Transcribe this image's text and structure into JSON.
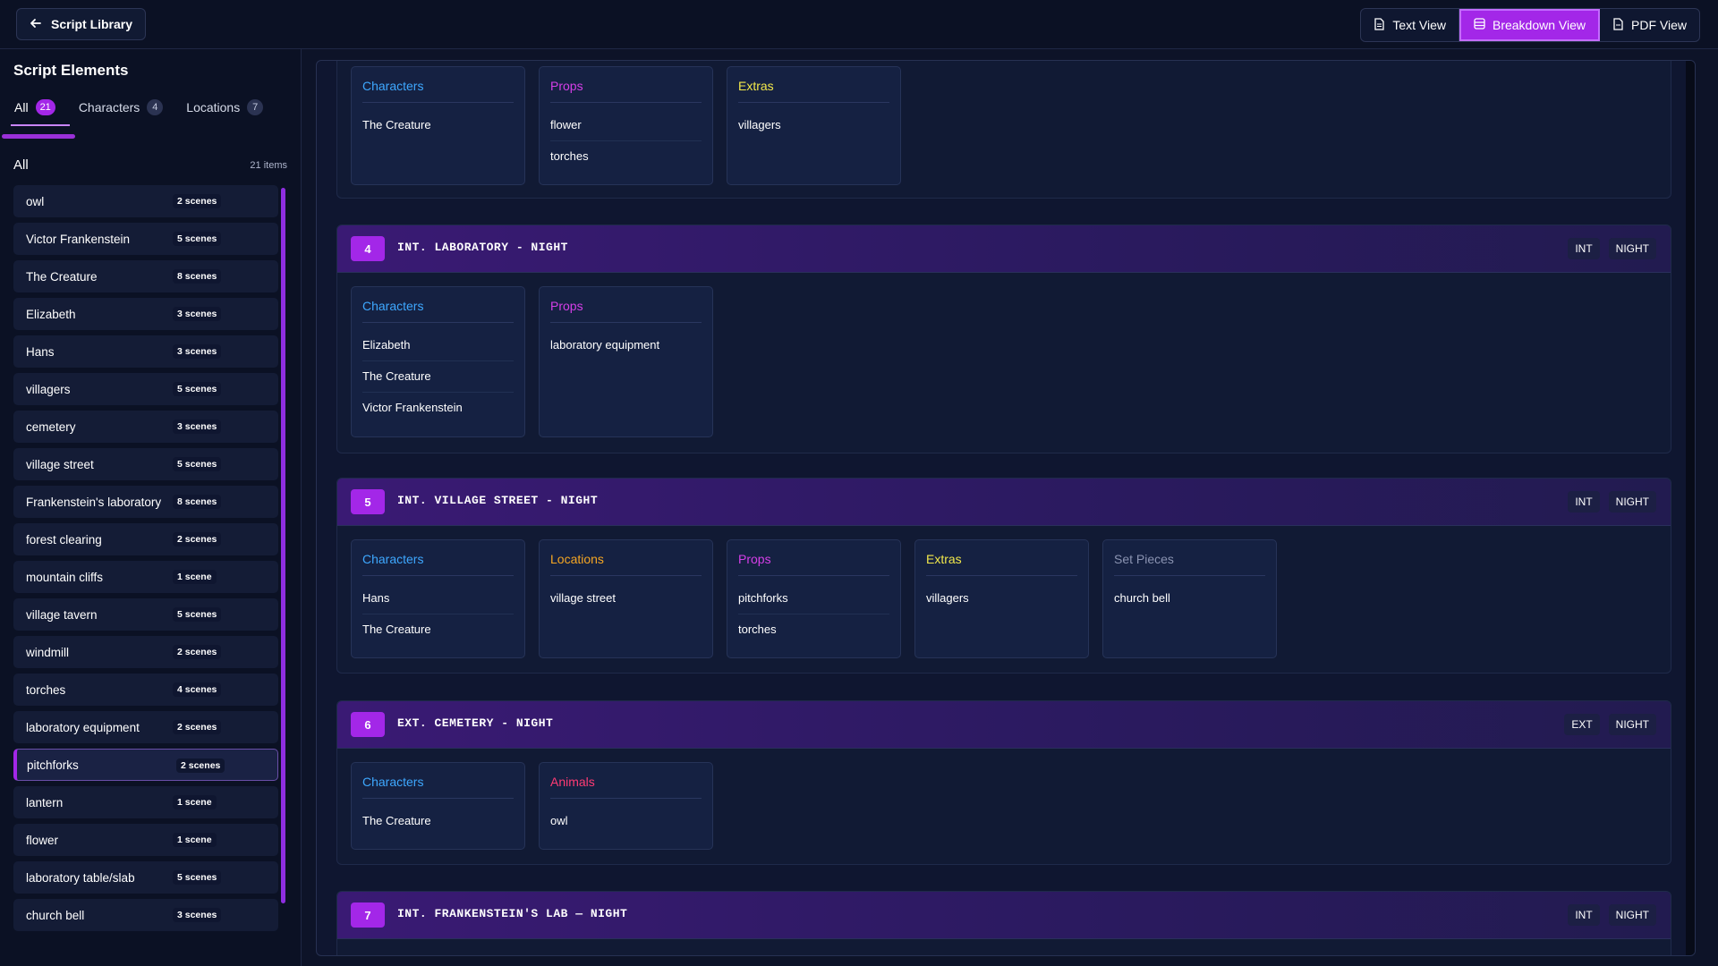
{
  "header": {
    "back_label": "Script Library",
    "views": [
      {
        "label": "Text View",
        "active": false
      },
      {
        "label": "Breakdown View",
        "active": true
      },
      {
        "label": "PDF View",
        "active": false
      }
    ]
  },
  "sidebar": {
    "title": "Script Elements",
    "tabs": [
      {
        "label": "All",
        "count": "21",
        "active": true
      },
      {
        "label": "Characters",
        "count": "4",
        "active": false
      },
      {
        "label": "Locations",
        "count": "7",
        "active": false
      }
    ],
    "list_title": "All",
    "list_count": "21 items",
    "items": [
      {
        "name": "owl",
        "scenes": "2 scenes"
      },
      {
        "name": "Victor Frankenstein",
        "scenes": "5 scenes"
      },
      {
        "name": "The Creature",
        "scenes": "8 scenes"
      },
      {
        "name": "Elizabeth",
        "scenes": "3 scenes"
      },
      {
        "name": "Hans",
        "scenes": "3 scenes"
      },
      {
        "name": "villagers",
        "scenes": "5 scenes"
      },
      {
        "name": "cemetery",
        "scenes": "3 scenes"
      },
      {
        "name": "village street",
        "scenes": "5 scenes"
      },
      {
        "name": "Frankenstein's laboratory",
        "scenes": "8 scenes"
      },
      {
        "name": "forest clearing",
        "scenes": "2 scenes"
      },
      {
        "name": "mountain cliffs",
        "scenes": "1 scene"
      },
      {
        "name": "village tavern",
        "scenes": "5 scenes"
      },
      {
        "name": "windmill",
        "scenes": "2 scenes"
      },
      {
        "name": "torches",
        "scenes": "4 scenes"
      },
      {
        "name": "laboratory equipment",
        "scenes": "2 scenes"
      },
      {
        "name": "pitchforks",
        "scenes": "2 scenes",
        "selected": true
      },
      {
        "name": "lantern",
        "scenes": "1 scene"
      },
      {
        "name": "flower",
        "scenes": "1 scene"
      },
      {
        "name": "laboratory table/slab",
        "scenes": "5 scenes"
      },
      {
        "name": "church bell",
        "scenes": "3 scenes"
      }
    ]
  },
  "colors": {
    "accent": "#a327e8",
    "characters": "#3ea8ff",
    "props": "#d63fe8",
    "extras": "#f2e84b",
    "locations": "#f5a623",
    "set_pieces": "#8a93b1",
    "animals": "#ff3b74"
  },
  "scenes": [
    {
      "number": "",
      "heading": "",
      "tags": [],
      "categories": [
        {
          "title": "Characters",
          "kind": "characters",
          "items": [
            "The Creature"
          ]
        },
        {
          "title": "Props",
          "kind": "props",
          "items": [
            "flower",
            "torches"
          ]
        },
        {
          "title": "Extras",
          "kind": "extras",
          "items": [
            "villagers"
          ]
        }
      ]
    },
    {
      "number": "4",
      "heading": "INT. LABORATORY - NIGHT",
      "tags": [
        "INT",
        "NIGHT"
      ],
      "categories": [
        {
          "title": "Characters",
          "kind": "characters",
          "items": [
            "Elizabeth",
            "The Creature",
            "Victor Frankenstein"
          ]
        },
        {
          "title": "Props",
          "kind": "props",
          "items": [
            "laboratory equipment"
          ]
        }
      ]
    },
    {
      "number": "5",
      "heading": "INT. VILLAGE STREET - NIGHT",
      "tags": [
        "INT",
        "NIGHT"
      ],
      "categories": [
        {
          "title": "Characters",
          "kind": "characters",
          "items": [
            "Hans",
            "The Creature"
          ]
        },
        {
          "title": "Locations",
          "kind": "locations",
          "items": [
            "village street"
          ]
        },
        {
          "title": "Props",
          "kind": "props",
          "items": [
            "pitchforks",
            "torches"
          ]
        },
        {
          "title": "Extras",
          "kind": "extras",
          "items": [
            "villagers"
          ]
        },
        {
          "title": "Set Pieces",
          "kind": "setpieces",
          "items": [
            "church bell"
          ]
        }
      ]
    },
    {
      "number": "6",
      "heading": "EXT. CEMETERY - NIGHT",
      "tags": [
        "EXT",
        "NIGHT"
      ],
      "categories": [
        {
          "title": "Characters",
          "kind": "characters",
          "items": [
            "The Creature"
          ]
        },
        {
          "title": "Animals",
          "kind": "animals",
          "items": [
            "owl"
          ]
        }
      ]
    },
    {
      "number": "7",
      "heading": "INT. FRANKENSTEIN'S LAB — NIGHT",
      "tags": [
        "INT",
        "NIGHT"
      ],
      "categories": []
    }
  ]
}
